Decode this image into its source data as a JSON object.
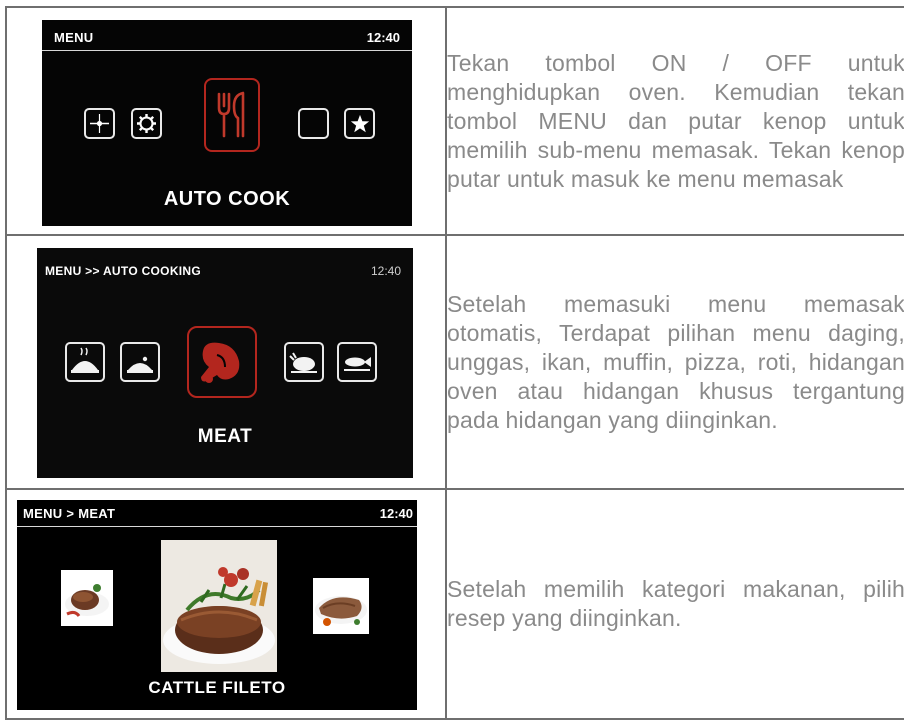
{
  "rows": [
    {
      "screen": {
        "breadcrumb": "MENU",
        "time": "12:40",
        "label": "AUTO COOK",
        "icons": [
          "clock-icon",
          "settings-gear-icon",
          "fork-knife-icon",
          "blank-icon",
          "star-icon"
        ]
      },
      "description": "Tekan tombol ON / OFF untuk menghidupkan oven. Kemudian tekan tombol MENU dan putar kenop untuk memilih sub-menu memasak. Tekan kenop putar untuk masuk ke menu memasak"
    },
    {
      "screen": {
        "breadcrumb": "MENU >> AUTO COOKING",
        "time": "12:40",
        "label": "MEAT",
        "icons": [
          "covered-dish-icon",
          "covered-dish-small-icon",
          "meat-leg-icon",
          "poultry-icon",
          "fish-icon"
        ]
      },
      "description": "Setelah memasuki menu memasak otomatis, Terdapat pilihan menu daging, unggas, ikan, muffin, pizza, roti, hidangan oven atau hidangan khusus tergantung pada hidangan yang diinginkan."
    },
    {
      "screen": {
        "breadcrumb": "MENU > MEAT",
        "time": "12:40",
        "label": "CATTLE FILETO",
        "photos": [
          "meat-dish-left",
          "steak-with-herbs-center",
          "roast-right"
        ]
      },
      "description": "Setelah memilih kategori makanan, pilih resep yang diinginkan."
    }
  ],
  "colors": {
    "screen_bg": "#050505",
    "selected_border": "#b3261e",
    "desc_text": "#8a8a8a",
    "table_border": "#6f6f6f"
  }
}
